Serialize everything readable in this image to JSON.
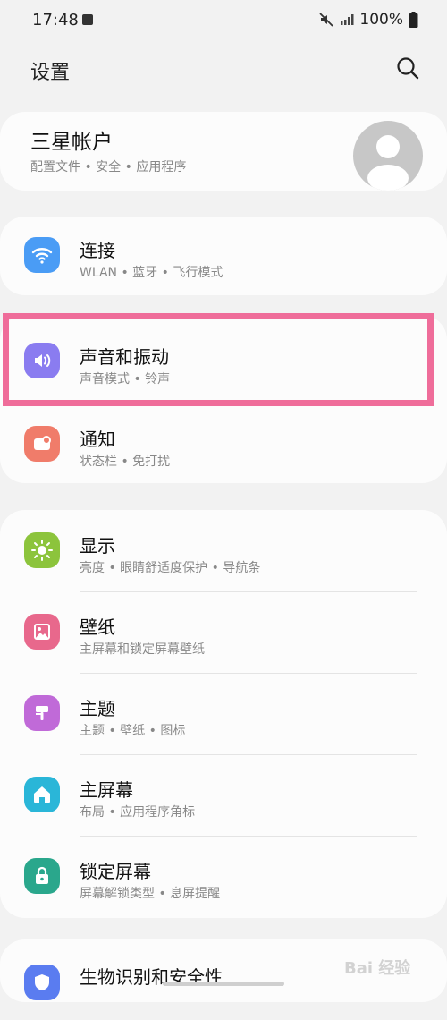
{
  "status": {
    "time": "17:48",
    "battery": "100%"
  },
  "header": {
    "title": "设置"
  },
  "account": {
    "title": "三星帐户",
    "subtitle": "配置文件 • 安全 • 应用程序"
  },
  "items": [
    {
      "title": "连接",
      "subtitle": "WLAN • 蓝牙 • 飞行模式",
      "icon": "wifi-icon",
      "color": "#4a9cf5"
    },
    {
      "title": "声音和振动",
      "subtitle": "声音模式 • 铃声",
      "icon": "volume-icon",
      "color": "#8a7cf0"
    },
    {
      "title": "通知",
      "subtitle": "状态栏 • 免打扰",
      "icon": "notification-icon",
      "color": "#f07c6a"
    },
    {
      "title": "显示",
      "subtitle": "亮度 • 眼睛舒适度保护 • 导航条",
      "icon": "brightness-icon",
      "color": "#8cc43c"
    },
    {
      "title": "壁纸",
      "subtitle": "主屏幕和锁定屏幕壁纸",
      "icon": "wallpaper-icon",
      "color": "#e8688c"
    },
    {
      "title": "主题",
      "subtitle": "主题 • 壁纸 • 图标",
      "icon": "theme-icon",
      "color": "#c06ad8"
    },
    {
      "title": "主屏幕",
      "subtitle": "布局 • 应用程序角标",
      "icon": "home-icon",
      "color": "#2ab6d8"
    },
    {
      "title": "锁定屏幕",
      "subtitle": "屏幕解锁类型 • 息屏提醒",
      "icon": "lock-icon",
      "color": "#2aa78c"
    },
    {
      "title": "生物识别和安全性",
      "subtitle": "",
      "icon": "security-icon",
      "color": "#5a7cf0"
    }
  ],
  "watermark": "Bai 经验"
}
